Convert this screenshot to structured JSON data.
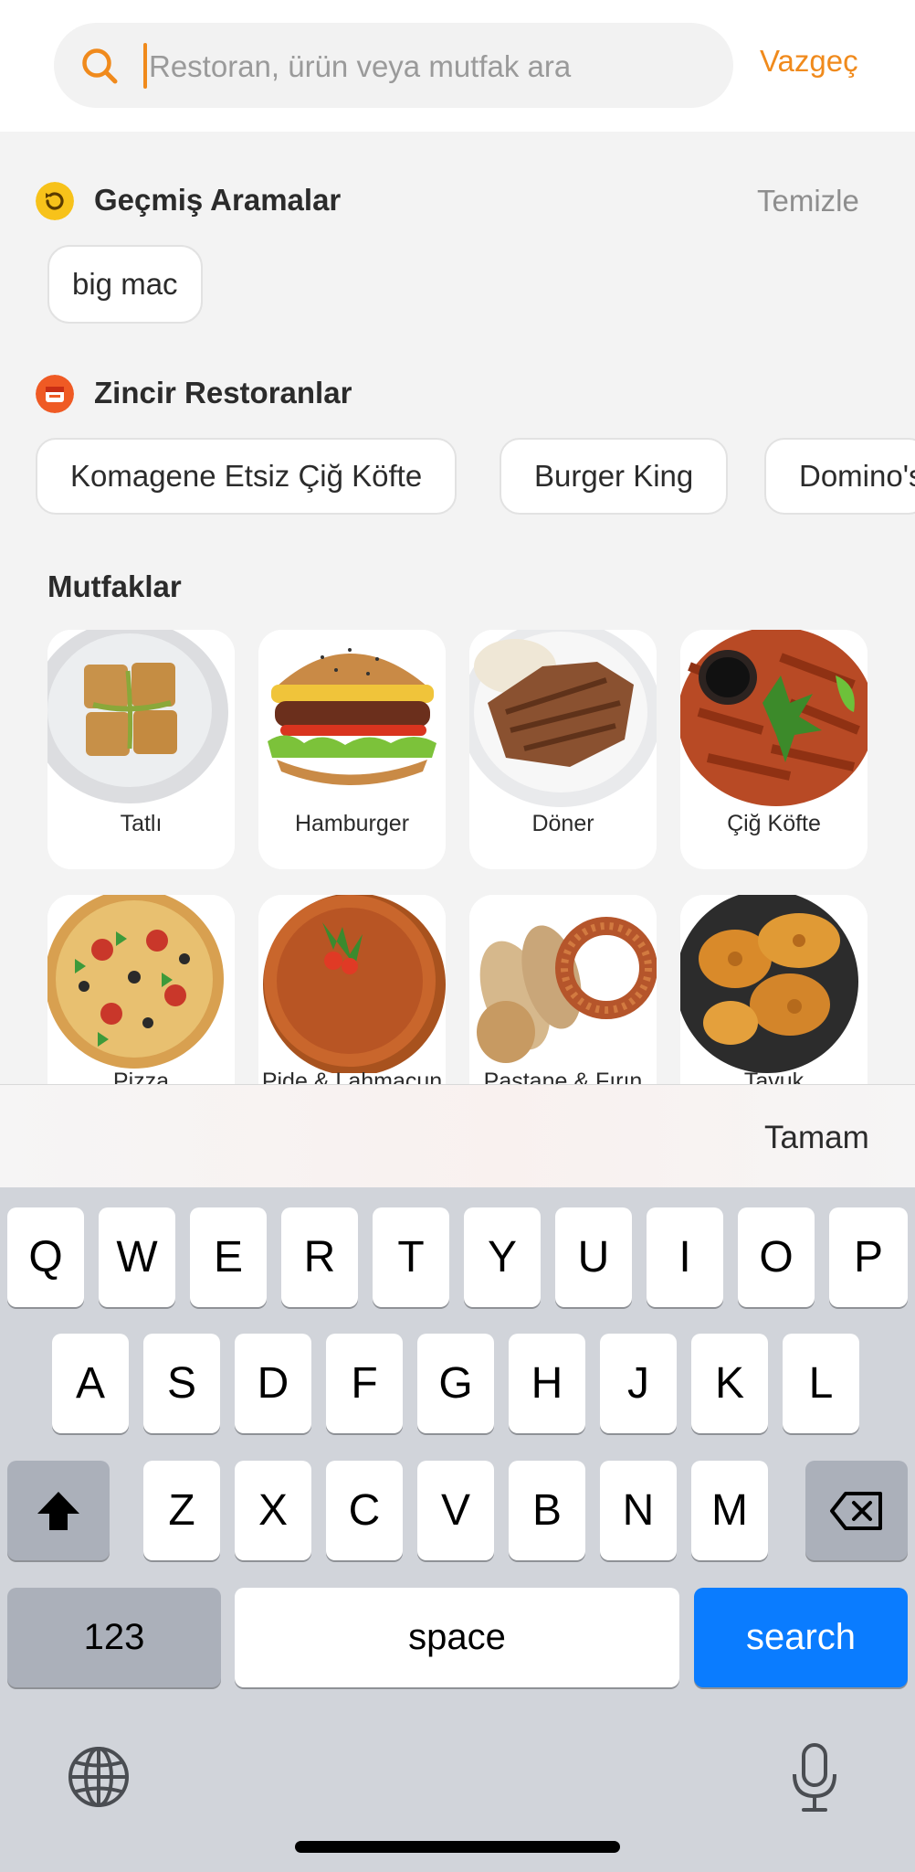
{
  "search": {
    "placeholder": "Restoran, ürün veya mutfak ara",
    "value": "",
    "cancel_label": "Vazgeç"
  },
  "recent": {
    "title": "Geçmiş Aramalar",
    "clear_label": "Temizle",
    "items": [
      "big mac"
    ]
  },
  "chains": {
    "title": "Zincir Restoranlar",
    "items": [
      "Komagene Etsiz Çiğ Köfte",
      "Burger King",
      "Domino's"
    ]
  },
  "cuisines": {
    "title": "Mutfaklar",
    "items": [
      {
        "label": "Tatlı",
        "icon": "baklava-image"
      },
      {
        "label": "Hamburger",
        "icon": "hamburger-image"
      },
      {
        "label": "Döner",
        "icon": "doner-image"
      },
      {
        "label": "Çiğ Köfte",
        "icon": "cig-kofte-image"
      },
      {
        "label": "Pizza",
        "icon": "pizza-image"
      },
      {
        "label": "Pide & Lahmacun",
        "icon": "lahmacun-image"
      },
      {
        "label": "Pastane & Fırın",
        "icon": "bakery-image"
      },
      {
        "label": "Tavuk",
        "icon": "fried-chicken-image"
      }
    ]
  },
  "accessory": {
    "done_label": "Tamam"
  },
  "keyboard": {
    "row1": [
      "Q",
      "W",
      "E",
      "R",
      "T",
      "Y",
      "U",
      "I",
      "O",
      "P"
    ],
    "row2": [
      "A",
      "S",
      "D",
      "F",
      "G",
      "H",
      "J",
      "K",
      "L"
    ],
    "row3": [
      "Z",
      "X",
      "C",
      "V",
      "B",
      "N",
      "M"
    ],
    "numbers_label": "123",
    "space_label": "space",
    "search_label": "search"
  },
  "colors": {
    "accent": "#f08a1c",
    "keyboard_bg": "#d1d4da",
    "search_key": "#0a7cff"
  }
}
